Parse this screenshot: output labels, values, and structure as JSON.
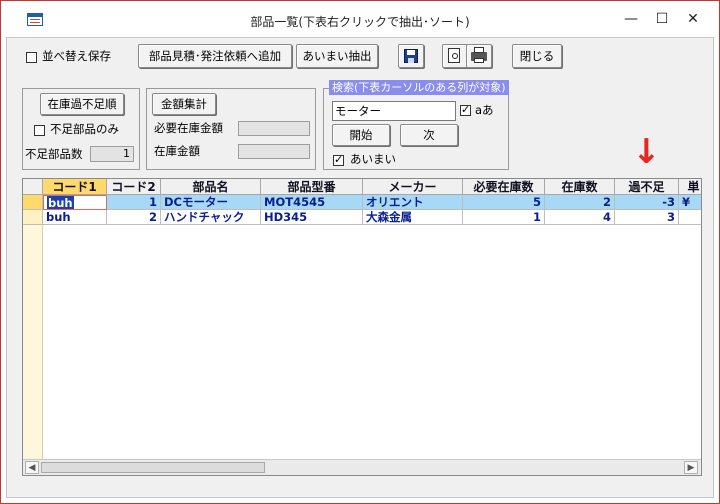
{
  "window": {
    "title": "部品一覧(下表右クリックで抽出･ソート)",
    "minimize": "—",
    "maximize": "☐",
    "close": "✕"
  },
  "toolbar": {
    "sort_save_label": "並べ替え保存",
    "sort_save_checked": false,
    "add_request_label": "部品見積･発注依頼へ追加",
    "fuzzy_extract_label": "あいまい抽出",
    "save_icon": "floppy-disk-icon",
    "preview_icon": "print-preview-icon",
    "print_icon": "printer-icon",
    "close_label": "閉じる"
  },
  "stock_panel": {
    "shortage_order_label": "在庫過不足順",
    "shortage_only_label": "不足部品のみ",
    "shortage_only_checked": false,
    "shortage_count_label": "不足部品数",
    "shortage_count_value": "1"
  },
  "amount_panel": {
    "calc_button_label": "金額集計",
    "required_amount_label": "必要在庫金額",
    "required_amount_value": "",
    "stock_amount_label": "在庫金額",
    "stock_amount_value": ""
  },
  "search": {
    "group_title": "検索(下表カーソルのある列が対象)",
    "query_value": "モーター",
    "kana_label": "aあ",
    "kana_checked": true,
    "start_label": "開始",
    "next_label": "次",
    "fuzzy_label": "あいまい",
    "fuzzy_checked": true
  },
  "annotation": {
    "arrow": "↓",
    "color": "#e8261f"
  },
  "grid": {
    "headers": [
      "コード1",
      "コード2",
      "部品名",
      "部品型番",
      "メーカー",
      "必要在庫数",
      "在庫数",
      "過不足",
      "単"
    ],
    "rows": [
      [
        "buh",
        "1",
        "DCモーター",
        "MOT4545",
        "オリエント",
        "5",
        "2",
        "-3",
        "¥"
      ],
      [
        "buh",
        "2",
        "ハンドチャック",
        "HD345",
        "大森金属",
        "1",
        "4",
        "3",
        ""
      ]
    ]
  },
  "colors": {
    "selected_row": "#a7d8f5",
    "selected_header": "#ffd96b",
    "cell_text": "#0a1f8f",
    "window_border": "#c0392b"
  }
}
